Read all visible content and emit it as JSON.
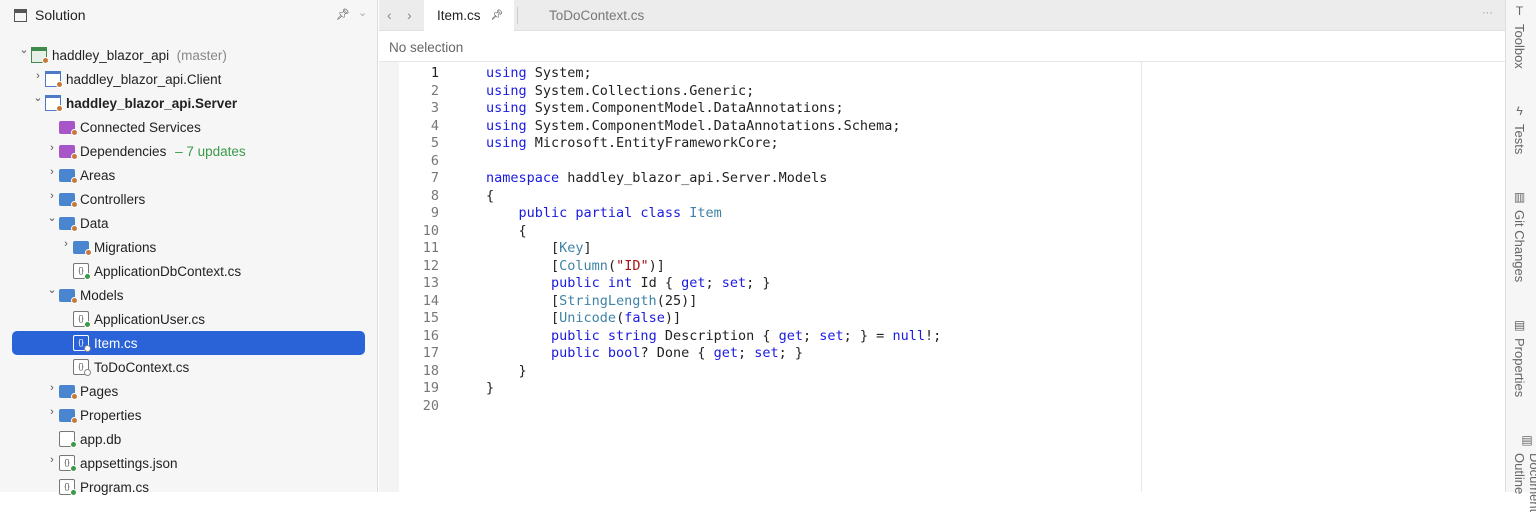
{
  "sidebar": {
    "title": "Solution",
    "tree": [
      {
        "level": 0,
        "arrow": "open",
        "icon": "sln",
        "label": "haddley_blazor_api",
        "extra": "(master)"
      },
      {
        "level": 1,
        "arrow": "closed",
        "icon": "proj",
        "label": "haddley_blazor_api.Client"
      },
      {
        "level": 1,
        "arrow": "open",
        "icon": "proj",
        "label": "haddley_blazor_api.Server",
        "bold": true
      },
      {
        "level": 2,
        "arrow": "none",
        "icon": "purple",
        "label": "Connected Services"
      },
      {
        "level": 2,
        "arrow": "closed",
        "icon": "purple",
        "label": "Dependencies",
        "update": "– 7 updates"
      },
      {
        "level": 2,
        "arrow": "closed",
        "icon": "folder",
        "label": "Areas"
      },
      {
        "level": 2,
        "arrow": "closed",
        "icon": "folder",
        "label": "Controllers"
      },
      {
        "level": 2,
        "arrow": "open",
        "icon": "folder",
        "label": "Data"
      },
      {
        "level": 3,
        "arrow": "closed",
        "icon": "folder",
        "label": "Migrations"
      },
      {
        "level": 3,
        "arrow": "none",
        "icon": "file-g",
        "label": "ApplicationDbContext.cs"
      },
      {
        "level": 2,
        "arrow": "open",
        "icon": "folder",
        "label": "Models"
      },
      {
        "level": 3,
        "arrow": "none",
        "icon": "file-g",
        "label": "ApplicationUser.cs"
      },
      {
        "level": 3,
        "arrow": "none",
        "icon": "file-o",
        "label": "Item.cs",
        "selected": true
      },
      {
        "level": 3,
        "arrow": "none",
        "icon": "file-o",
        "label": "ToDoContext.cs"
      },
      {
        "level": 2,
        "arrow": "closed",
        "icon": "folder",
        "label": "Pages"
      },
      {
        "level": 2,
        "arrow": "closed",
        "icon": "folder",
        "label": "Properties"
      },
      {
        "level": 2,
        "arrow": "none",
        "icon": "blank-g",
        "label": "app.db"
      },
      {
        "level": 2,
        "arrow": "closed",
        "icon": "file-g",
        "label": "appsettings.json"
      },
      {
        "level": 2,
        "arrow": "none",
        "icon": "file-g",
        "label": "Program.cs"
      }
    ]
  },
  "tabs": {
    "active": "Item.cs",
    "other": "ToDoContext.cs"
  },
  "breadcrumb": "No selection",
  "editor": {
    "current_line": 1,
    "lines": [
      [
        [
          "kw",
          "using"
        ],
        [
          "t",
          " System;"
        ]
      ],
      [
        [
          "kw",
          "using"
        ],
        [
          "t",
          " System.Collections.Generic;"
        ]
      ],
      [
        [
          "kw",
          "using"
        ],
        [
          "t",
          " System.ComponentModel.DataAnnotations;"
        ]
      ],
      [
        [
          "kw",
          "using"
        ],
        [
          "t",
          " System.ComponentModel.DataAnnotations.Schema;"
        ]
      ],
      [
        [
          "kw",
          "using"
        ],
        [
          "t",
          " Microsoft.EntityFrameworkCore;"
        ]
      ],
      [],
      [
        [
          "kw",
          "namespace"
        ],
        [
          "t",
          " haddley_blazor_api.Server.Models"
        ]
      ],
      [
        [
          "t",
          "{"
        ]
      ],
      [
        [
          "t",
          "    "
        ],
        [
          "kw",
          "public partial class"
        ],
        [
          "t",
          " "
        ],
        [
          "ty",
          "Item"
        ]
      ],
      [
        [
          "t",
          "    {"
        ]
      ],
      [
        [
          "t",
          "        ["
        ],
        [
          "ty",
          "Key"
        ],
        [
          "t",
          "]"
        ]
      ],
      [
        [
          "t",
          "        ["
        ],
        [
          "ty",
          "Column"
        ],
        [
          "t",
          "("
        ],
        [
          "st",
          "\"ID\""
        ],
        [
          "t",
          ")]"
        ]
      ],
      [
        [
          "t",
          "        "
        ],
        [
          "kw",
          "public int"
        ],
        [
          "t",
          " Id { "
        ],
        [
          "kw",
          "get"
        ],
        [
          "t",
          "; "
        ],
        [
          "kw",
          "set"
        ],
        [
          "t",
          "; }"
        ]
      ],
      [
        [
          "t",
          "        ["
        ],
        [
          "ty",
          "StringLength"
        ],
        [
          "t",
          "(25)]"
        ]
      ],
      [
        [
          "t",
          "        ["
        ],
        [
          "ty",
          "Unicode"
        ],
        [
          "t",
          "("
        ],
        [
          "kw",
          "false"
        ],
        [
          "t",
          ")]"
        ]
      ],
      [
        [
          "t",
          "        "
        ],
        [
          "kw",
          "public string"
        ],
        [
          "t",
          " Description { "
        ],
        [
          "kw",
          "get"
        ],
        [
          "t",
          "; "
        ],
        [
          "kw",
          "set"
        ],
        [
          "t",
          "; } = "
        ],
        [
          "kw",
          "null"
        ],
        [
          "t",
          "!;"
        ]
      ],
      [
        [
          "t",
          "        "
        ],
        [
          "kw",
          "public bool"
        ],
        [
          "t",
          "? Done { "
        ],
        [
          "kw",
          "get"
        ],
        [
          "t",
          "; "
        ],
        [
          "kw",
          "set"
        ],
        [
          "t",
          "; }"
        ]
      ],
      [
        [
          "t",
          "    }"
        ]
      ],
      [
        [
          "t",
          "}"
        ]
      ],
      []
    ]
  },
  "right_panels": [
    "Toolbox",
    "Tests",
    "Git Changes",
    "Properties",
    "Document Outline"
  ],
  "colors": {
    "keyword": "#1a1ae0",
    "type": "#3f83a6",
    "string": "#a31515",
    "selection": "#2a62d8"
  }
}
